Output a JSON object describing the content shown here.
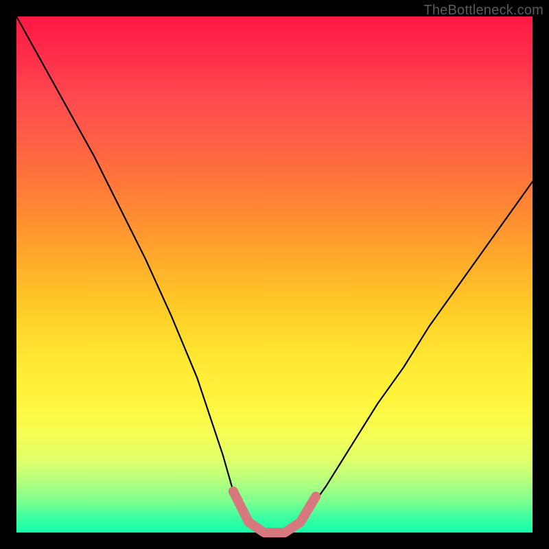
{
  "watermark": "TheBottleneck.com",
  "colors": {
    "background": "#000000",
    "curve_stroke": "#000000",
    "highlight_stroke": "#d6787d"
  },
  "chart_data": {
    "type": "line",
    "title": "",
    "xlabel": "",
    "ylabel": "",
    "xlim": [
      0,
      100
    ],
    "ylim": [
      0,
      100
    ],
    "grid": false,
    "legend": false,
    "annotations": [
      "TheBottleneck.com"
    ],
    "series": [
      {
        "name": "bottleneck-curve",
        "x": [
          0,
          5,
          10,
          15,
          20,
          25,
          30,
          35,
          40,
          42,
          45,
          48,
          50,
          52,
          55,
          60,
          65,
          70,
          75,
          80,
          85,
          90,
          95,
          100
        ],
        "y": [
          100,
          91,
          82,
          73,
          63,
          53,
          42,
          30,
          15,
          8,
          2,
          0,
          0,
          0,
          2,
          9,
          17,
          25,
          32,
          40,
          47,
          54,
          61,
          68
        ]
      },
      {
        "name": "optimal-region-highlight",
        "x": [
          42,
          45,
          48,
          50,
          52,
          55,
          58
        ],
        "y": [
          8,
          2,
          0,
          0,
          0,
          2,
          7
        ]
      }
    ]
  }
}
